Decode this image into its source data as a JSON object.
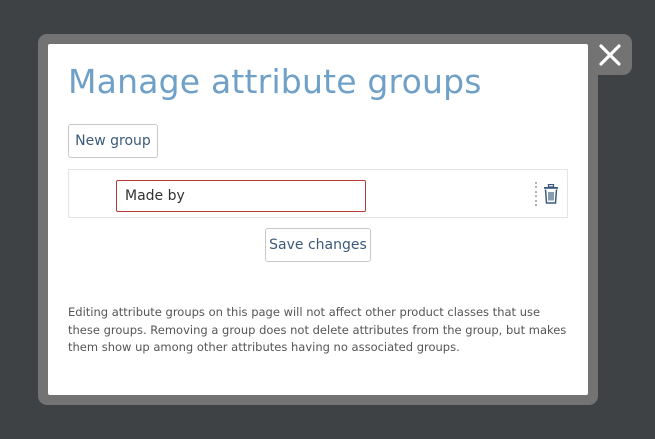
{
  "dialog": {
    "title": "Manage attribute groups",
    "new_group_label": "New group",
    "groups": [
      {
        "name": "Made by"
      }
    ],
    "save_label": "Save changes",
    "note": "Editing attribute groups on this page will not affect other product classes that use these groups. Removing a group does not delete attributes from the group, but makes them show up among other attributes having no associated groups."
  },
  "icons": {
    "close": "close-icon",
    "drag": "drag-handle-icon",
    "delete": "trash-icon"
  },
  "colors": {
    "title": "#6fa0c7",
    "button_text": "#3b5a7a",
    "input_error_border": "#b23a3a",
    "overlay": "#3f4245",
    "frame": "#737373"
  }
}
